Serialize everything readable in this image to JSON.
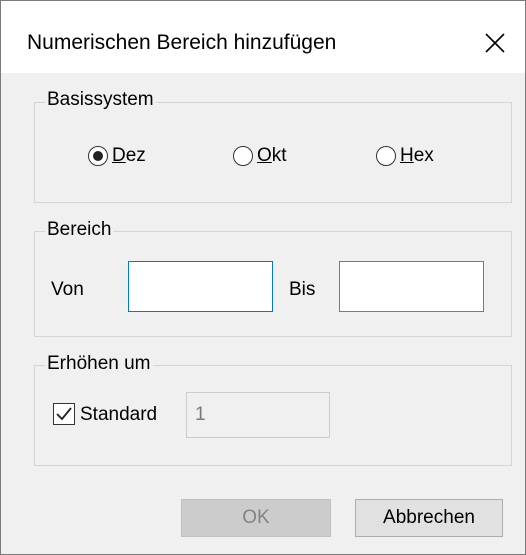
{
  "dialog": {
    "title": "Numerischen Bereich hinzufügen",
    "close_icon": "close-icon"
  },
  "basis": {
    "legend": "Basissystem",
    "options": [
      {
        "mnemonic": "D",
        "rest": "ez",
        "selected": true
      },
      {
        "mnemonic": "O",
        "rest": "kt",
        "selected": false
      },
      {
        "mnemonic": "H",
        "rest": "ex",
        "selected": false
      }
    ]
  },
  "range": {
    "legend": "Bereich",
    "from_label": "Von",
    "from_value": "",
    "to_label": "Bis",
    "to_value": ""
  },
  "increment": {
    "legend": "Erhöhen um",
    "default_label": "Standard",
    "default_checked": true,
    "value": "1"
  },
  "buttons": {
    "ok": "OK",
    "cancel": "Abbrechen"
  }
}
